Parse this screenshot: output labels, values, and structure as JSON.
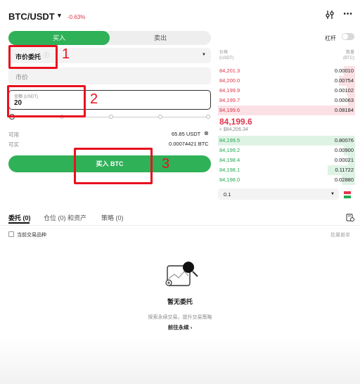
{
  "header": {
    "pair": "BTC/USDT",
    "change": "-0.63%",
    "icons": [
      "chevron-down-icon",
      "adjust-icon",
      "more-icon"
    ]
  },
  "tabs": {
    "buy": "买入",
    "sell": "卖出"
  },
  "leverage": {
    "label": "杠杆",
    "enabled": false
  },
  "order_form": {
    "order_type": "市价委托",
    "price_placeholder": "市价",
    "amount_label": "金额 (USDT)",
    "amount_value": "20",
    "available_label": "可用",
    "available_value": "65.85 USDT",
    "buyable_label": "可买",
    "buyable_value": "0.00074421 BTC",
    "submit_label": "买入 BTC"
  },
  "annotations": {
    "one": "1",
    "two": "2",
    "three": "3"
  },
  "order_book": {
    "price_header": [
      "价格",
      "(USDT)"
    ],
    "qty_header": [
      "数量",
      "(BTC)"
    ],
    "asks": [
      {
        "price": "84,201.3",
        "qty": "0.00010",
        "depth": 0.08
      },
      {
        "price": "84,200.0",
        "qty": "0.00754",
        "depth": 0.12
      },
      {
        "price": "84,199.9",
        "qty": "0.00102",
        "depth": 0.06
      },
      {
        "price": "84,199.7",
        "qty": "0.00063",
        "depth": 0.05
      },
      {
        "price": "84,199.6",
        "qty": "0.08184",
        "depth": 1.0
      }
    ],
    "last_price": "84,199.6",
    "last_price_usd": "≈ $84,206.34",
    "bids": [
      {
        "price": "84,199.5",
        "qty": "0.80076",
        "depth": 1.0
      },
      {
        "price": "84,199.2",
        "qty": "0.00900",
        "depth": 0.08
      },
      {
        "price": "84,198.4",
        "qty": "0.00021",
        "depth": 0.05
      },
      {
        "price": "84,198.1",
        "qty": "0.11722",
        "depth": 0.2
      },
      {
        "price": "84,198.0",
        "qty": "0.02880",
        "depth": 0.1
      }
    ],
    "depth_step": "0.1"
  },
  "bottom_tabs": {
    "orders": "委托 (0)",
    "positions": "仓位 (0) 和资产",
    "strategy": "策略 (0)"
  },
  "current_only_label": "当前交易品种",
  "batch_cancel_label": "批量撤单",
  "empty_state": {
    "title": "暂无委托",
    "subtitle": "探索永续交易，提升交易策略",
    "link": "前往永续 ›"
  },
  "colors": {
    "buy_green": "#2fb158",
    "sell_red": "#e0354a",
    "annotation_red": "#e8101e"
  }
}
